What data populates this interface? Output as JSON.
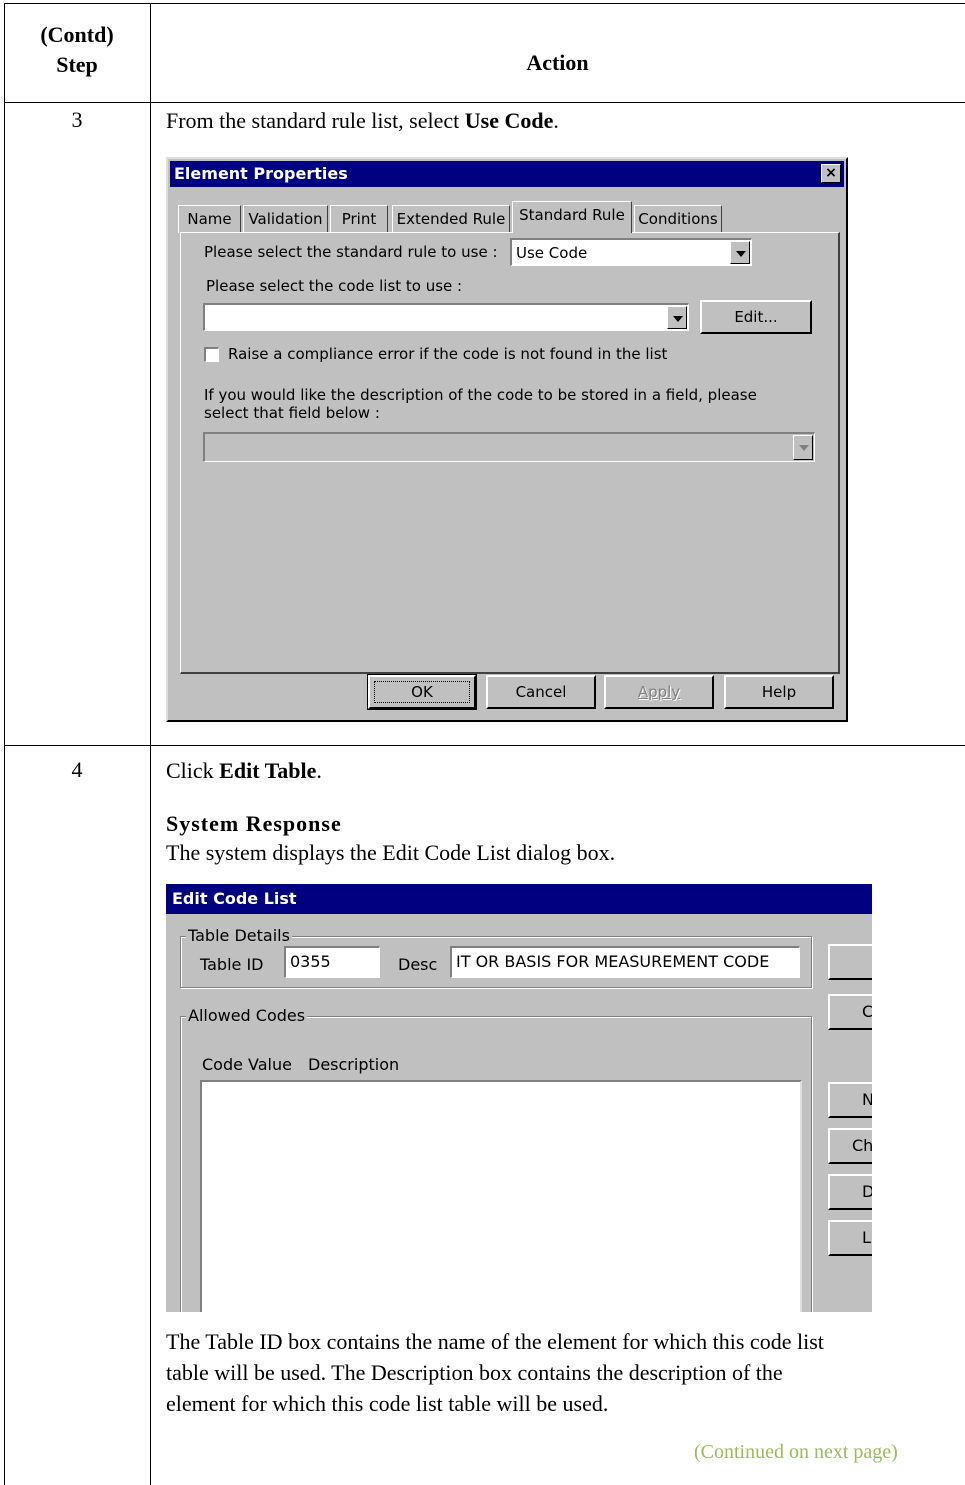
{
  "table": {
    "header_step": "(Contd)\nStep",
    "header_step_line1": "(Contd)",
    "header_step_line2": "Step",
    "header_action": "Action"
  },
  "step3": {
    "number": "3",
    "text_prefix": "From the standard rule list, select ",
    "text_bold": "Use Code",
    "text_suffix": "."
  },
  "element_properties": {
    "title": "Element Properties",
    "close_glyph": "×",
    "tabs": [
      "Name",
      "Validation",
      "Print",
      "Extended Rule",
      "Standard Rule",
      "Conditions"
    ],
    "active_tab": "Standard Rule",
    "rule_label": "Please select the standard rule to use :",
    "rule_value": "Use Code",
    "code_list_label": "Please select the code list to use :",
    "code_list_value": "",
    "edit_button": "Edit...",
    "checkbox_label": "Raise a compliance error if the code is not found in the list",
    "checkbox_checked": false,
    "desc_field_label_1": "If you would like the description of the code to be stored in a field, please",
    "desc_field_label_2": "select that field below :",
    "desc_field_value": "",
    "buttons": {
      "ok": "OK",
      "cancel": "Cancel",
      "apply": "Apply",
      "help": "Help"
    }
  },
  "step4": {
    "number": "4",
    "text_prefix": "Click ",
    "text_bold": "Edit Table",
    "text_suffix": ".",
    "response_heading": "System Response",
    "response_text": "The system displays the Edit Code List dialog box.",
    "after_text_1": "The Table ID box contains the name of the element for which this code list",
    "after_text_2": "table will be used. The Description box contains the description of the",
    "after_text_3": "element for which this code list table will be used."
  },
  "edit_code_list": {
    "title": "Edit Code List",
    "table_details_label": "Table Details",
    "table_id_label": "Table ID",
    "table_id_value": "0355",
    "desc_label": "Desc",
    "desc_value": "IT OR BASIS FOR MEASUREMENT CODE",
    "allowed_codes_label": "Allowed Codes",
    "col_code_value": "Code Value",
    "col_description": "Description",
    "side_buttons": [
      "",
      "C",
      "N",
      "Ch",
      "D",
      "L"
    ]
  },
  "footer": {
    "continued": "(Continued on next page)"
  },
  "colors": {
    "title_bar": "#000080",
    "dialog_face": "#c0c0c0",
    "continued_text": "#9bbb59"
  }
}
